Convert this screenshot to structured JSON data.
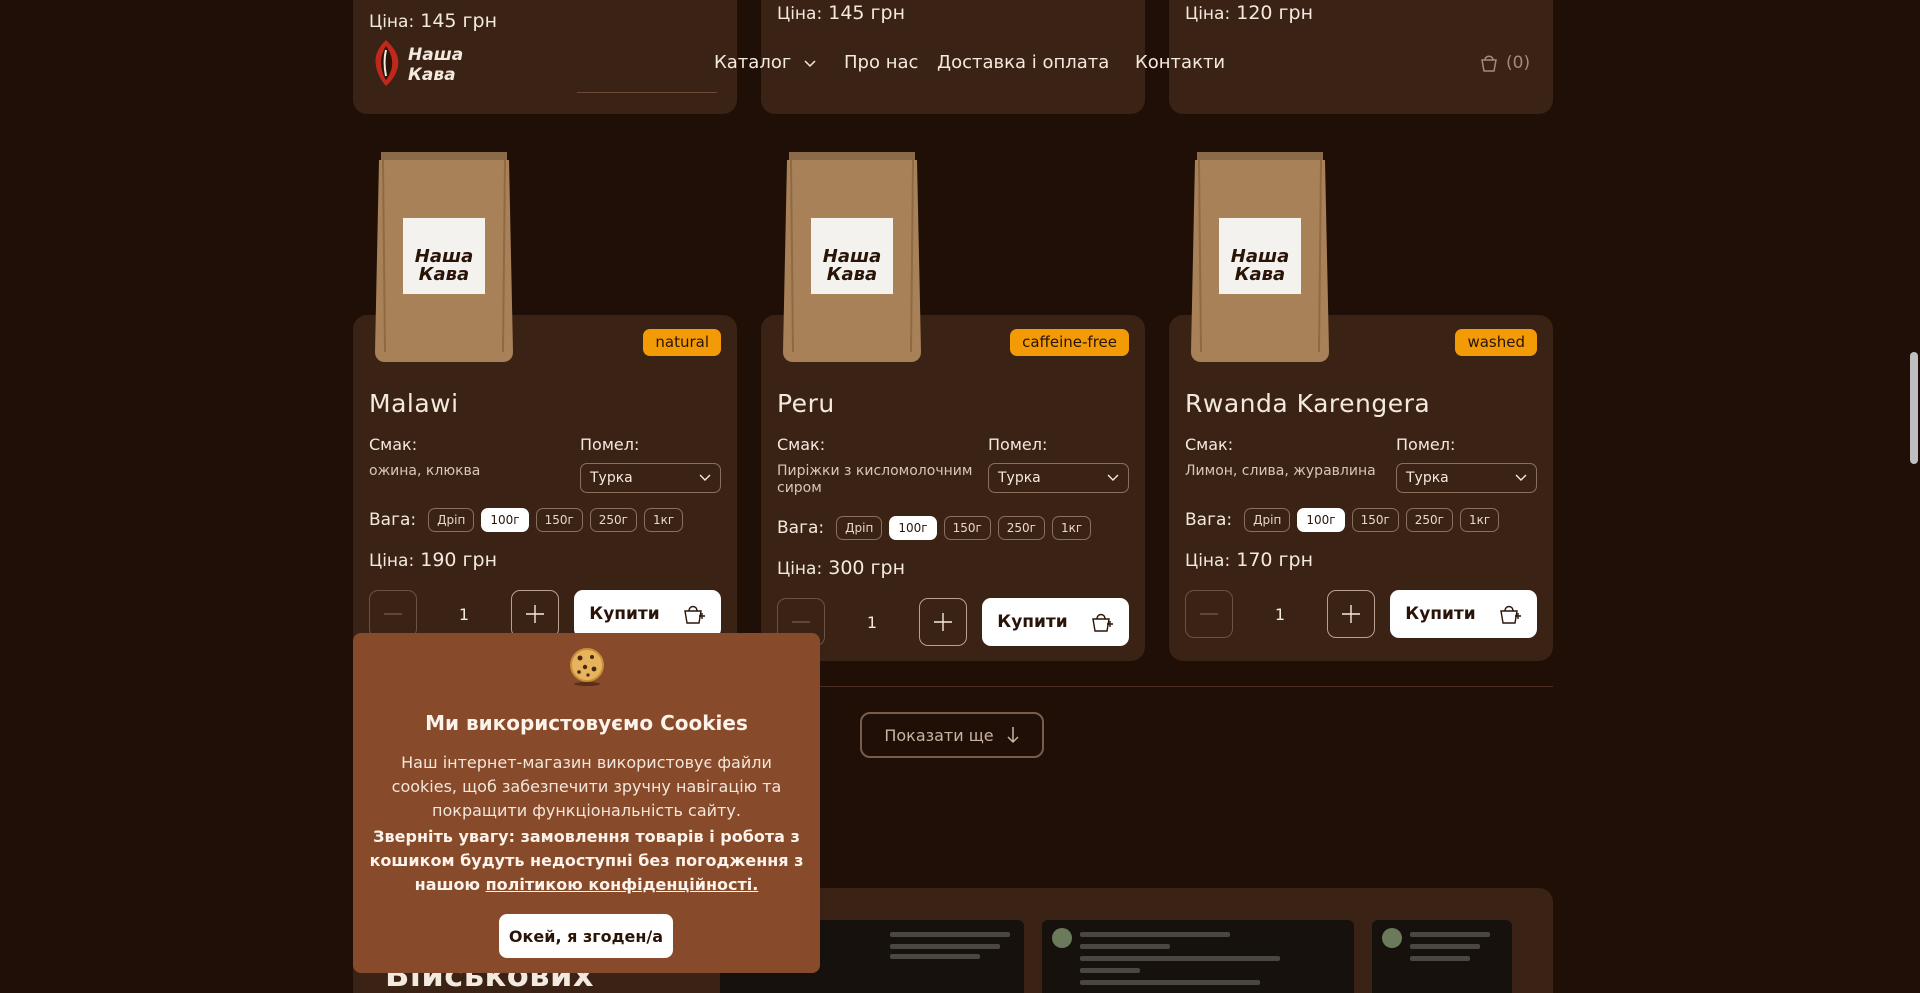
{
  "header": {
    "logo_text": "Наша Кава",
    "nav": [
      {
        "label": "Каталог"
      },
      {
        "label": "Про нас"
      },
      {
        "label": "Доставка і оплата"
      },
      {
        "label": "Контакти"
      }
    ],
    "cart_count": "(0)"
  },
  "previous_row": [
    {
      "price_label": "Ціна:",
      "price_value": "145 грн"
    },
    {
      "price_label": "Ціна:",
      "price_value": "145 грн"
    },
    {
      "price_label": "Ціна:",
      "price_value": "120 грн"
    }
  ],
  "products": [
    {
      "name": "Malawi",
      "badge": "natural",
      "taste_label": "Смак:",
      "taste": "ожина, клюква",
      "grind_label": "Помел:",
      "grind": "Турка",
      "weight_label": "Вага:",
      "weights": [
        "Дріп",
        "100г",
        "150г",
        "250г",
        "1кг"
      ],
      "active_weight": "100г",
      "price_label": "Ціна:",
      "price": "190 грн",
      "qty": "1",
      "buy_label": "Купити"
    },
    {
      "name": "Peru",
      "badge": "caffeine-free",
      "taste_label": "Смак:",
      "taste": "Пиріжки з кисломолочним сиром",
      "grind_label": "Помел:",
      "grind": "Турка",
      "weight_label": "Вага:",
      "weights": [
        "Дріп",
        "100г",
        "150г",
        "250г",
        "1кг"
      ],
      "active_weight": "100г",
      "price_label": "Ціна:",
      "price": "300 грн",
      "qty": "1",
      "buy_label": "Купити"
    },
    {
      "name": "Rwanda Karengera",
      "badge": "washed",
      "taste_label": "Смак:",
      "taste": "Лимон, слива, журавлина",
      "grind_label": "Помел:",
      "grind": "Турка",
      "weight_label": "Вага:",
      "weights": [
        "Дріп",
        "100г",
        "150г",
        "250г",
        "1кг"
      ],
      "active_weight": "100г",
      "price_label": "Ціна:",
      "price": "170 грн",
      "qty": "1",
      "buy_label": "Купити"
    }
  ],
  "show_more": "Показати ще",
  "reviews_heading": "Військових",
  "cookie": {
    "title": "Ми використовуємо Cookies",
    "text": "Наш інтернет-магазин використовує файли cookies, щоб забезпечити зручну навігацію та покращити функціональність сайту.",
    "warning": "Зверніть увагу: замовлення товарів і робота з кошиком будуть недоступні без погодження з нашою",
    "link": "політикою конфіденційності.",
    "button": "Окей, я згоден/а"
  },
  "colors": {
    "background": "#200f06",
    "card": "#3a2214",
    "badge": "#f39a07",
    "cookie_bg": "#874a2a"
  }
}
